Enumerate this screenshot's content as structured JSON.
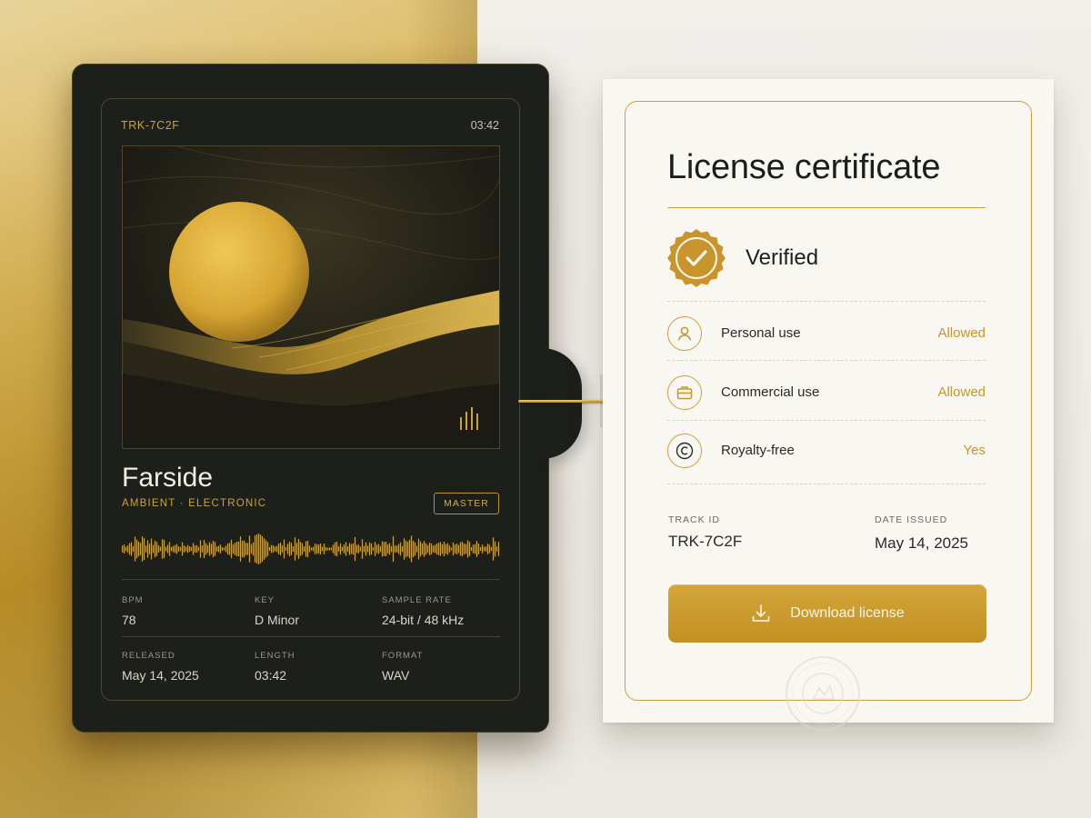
{
  "track_card": {
    "track_id": "TRK-7C2F",
    "duration": "03:42",
    "title": "Farside",
    "genre": "AMBIENT · ELECTRONIC",
    "badge": "MASTER",
    "artwork_icon": "equalizer-bars-icon",
    "meta": {
      "bpm_label": "BPM",
      "bpm": "78",
      "key_label": "KEY",
      "key": "D Minor",
      "sample_rate_label": "SAMPLE RATE",
      "sample_rate": "24-bit / 48 kHz",
      "released_label": "RELEASED",
      "released": "May 14, 2025",
      "length_label": "LENGTH",
      "length": "03:42",
      "format_label": "FORMAT",
      "format": "WAV"
    }
  },
  "certificate": {
    "title": "License certificate",
    "status": "Verified",
    "status_icon": "checkmark-seal-icon",
    "permissions": [
      {
        "label": "Personal use",
        "value": "Allowed",
        "icon": "user-icon"
      },
      {
        "label": "Commercial use",
        "value": "Allowed",
        "icon": "briefcase-icon"
      },
      {
        "label": "Royalty-free",
        "value": "Yes",
        "icon": "copyright-icon"
      }
    ],
    "track_id_label": "TRACK ID",
    "track_id": "TRK-7C2F",
    "date_label": "DATE ISSUED",
    "date": "May 14, 2025",
    "download_label": "Download license",
    "download_icon": "download-icon"
  },
  "colors": {
    "gold": "#cf9f3e",
    "card_dark": "#1d1f1b",
    "paper": "#f8f7f2"
  }
}
